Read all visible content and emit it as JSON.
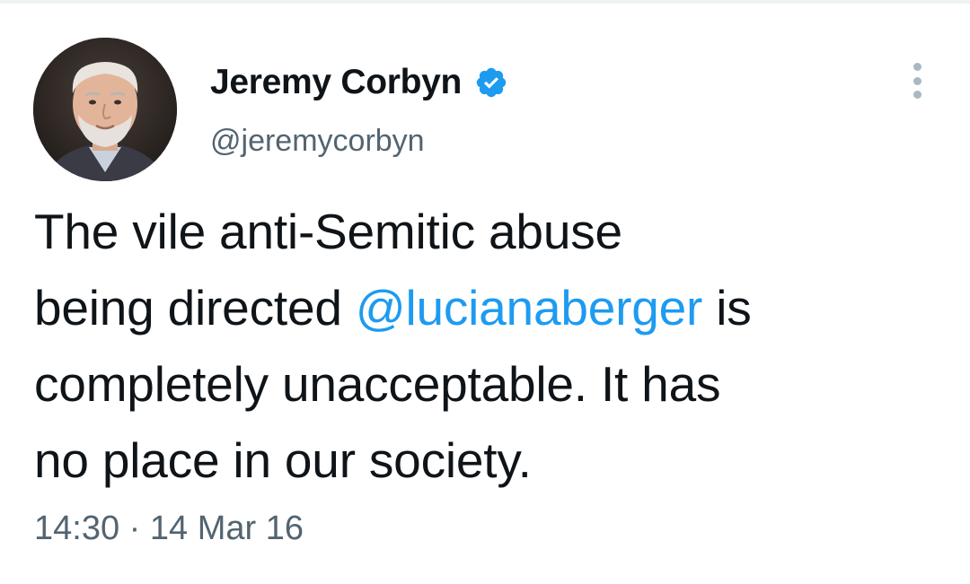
{
  "tweet": {
    "author": {
      "display_name": "Jeremy Corbyn",
      "handle": "@jeremycorbyn",
      "verified": true,
      "avatar_icon": "profile-photo"
    },
    "text": {
      "line1": "The vile anti-Semitic abuse",
      "line2_before": "being directed ",
      "mention": "@lucianaberger",
      "line2_after": " is",
      "line3": "completely unacceptable. It has",
      "line4": "no place in our society."
    },
    "time": "14:30",
    "separator": "·",
    "date": "14 Mar 16",
    "more_icon": "more-vertical-icon"
  },
  "colors": {
    "text_primary": "#0f1419",
    "text_secondary": "#536471",
    "accent": "#1d9bf0",
    "verified": "#1d9bf0"
  }
}
